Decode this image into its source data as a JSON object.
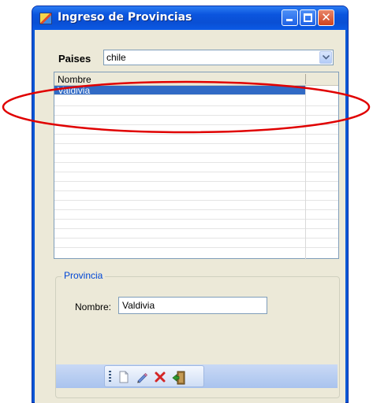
{
  "window": {
    "title": "Ingreso de Provincias",
    "title_bar_color": "#0a57d6",
    "controls": [
      "minimize-icon",
      "maximize-icon",
      "close-icon"
    ]
  },
  "paises": {
    "label": "Paises",
    "selected": "chile"
  },
  "grid": {
    "column_header": "Nombre",
    "rows": [
      {
        "nombre": "Valdivia",
        "selected": true
      }
    ],
    "selection_color": "#316ac5"
  },
  "provincia_group": {
    "title": "Provincia",
    "nombre_label": "Nombre:",
    "nombre_value": "Valdivia"
  },
  "toolbar": {
    "buttons": [
      "new-icon",
      "edit-icon",
      "delete-icon",
      "exit-icon"
    ]
  },
  "annotation": {
    "ellipse_color": "#e00000"
  }
}
